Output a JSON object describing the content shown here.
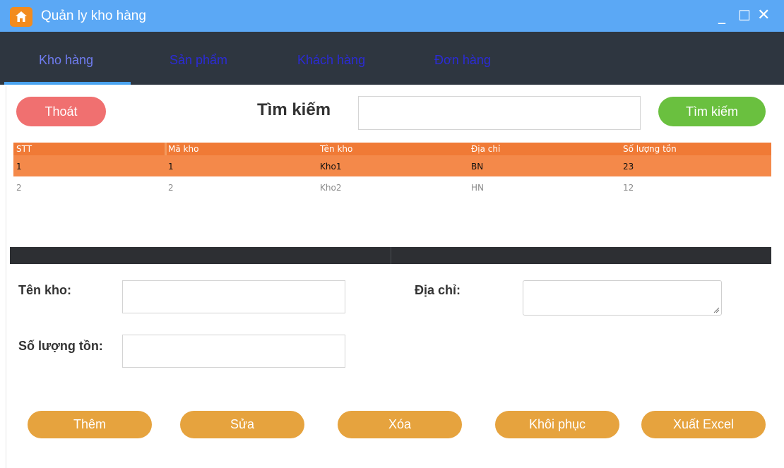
{
  "window": {
    "title": "Quản ly kho hàng",
    "controls": {
      "minimize": "_",
      "maximize": "☐",
      "close": "✕"
    }
  },
  "tabs": [
    {
      "label": "Kho hàng",
      "active": true
    },
    {
      "label": "Sản phẩm",
      "active": false
    },
    {
      "label": "Khách hàng",
      "active": false
    },
    {
      "label": "Đơn hàng",
      "active": false
    }
  ],
  "toolbar": {
    "exit_label": "Thoát",
    "search_title": "Tìm kiếm",
    "search_value": "",
    "search_button_label": "Tìm kiếm"
  },
  "table": {
    "headers": [
      "STT",
      "Mã kho",
      "Tên kho",
      "Địa chỉ",
      "Số lượng tồn"
    ],
    "rows": [
      {
        "selected": true,
        "cells": [
          "1",
          "1",
          "Kho1",
          "BN",
          "23"
        ]
      },
      {
        "selected": false,
        "cells": [
          "2",
          "2",
          "Kho2",
          "HN",
          "12"
        ]
      }
    ]
  },
  "form": {
    "name_label": "Tên kho:",
    "name_value": "",
    "address_label": "Địa chỉ:",
    "address_value": "",
    "quantity_label": "Số lượng tồn:",
    "quantity_value": ""
  },
  "actions": {
    "add": "Thêm",
    "edit": "Sửa",
    "delete": "Xóa",
    "restore": "Khôi phục",
    "export": "Xuất Excel"
  },
  "colors": {
    "titlebar": "#5ba8f5",
    "tabbar": "#2e3640",
    "active_tab": "#6f7cf0",
    "inactive_tab": "#2b2bd6",
    "table_header": "#f07a36",
    "selected_row": "#f4894a",
    "exit_button": "#f07070",
    "search_button": "#6ac03f",
    "action_button": "#e6a33e"
  }
}
